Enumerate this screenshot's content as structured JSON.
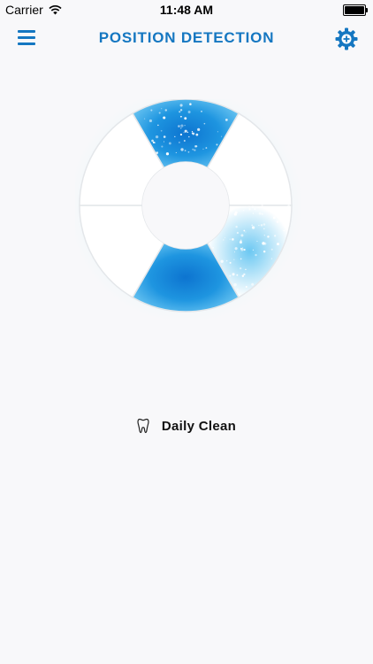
{
  "status_bar": {
    "carrier": "Carrier",
    "time": "11:48 AM"
  },
  "nav": {
    "title": "POSITION DETECTION",
    "menu_icon": "menu-icon",
    "settings_icon": "gear-icon"
  },
  "mode": {
    "label": "Daily Clean",
    "icon": "tooth-icon"
  },
  "colors": {
    "accent": "#1577c1",
    "zone_active": "#1e95e0",
    "zone_inactive": "#ffffff"
  },
  "zones": [
    {
      "name": "upper-front",
      "active": true
    },
    {
      "name": "upper-right",
      "active": false
    },
    {
      "name": "lower-right",
      "active": true
    },
    {
      "name": "lower-front",
      "active": true
    },
    {
      "name": "lower-left",
      "active": false
    },
    {
      "name": "upper-left",
      "active": false
    }
  ]
}
